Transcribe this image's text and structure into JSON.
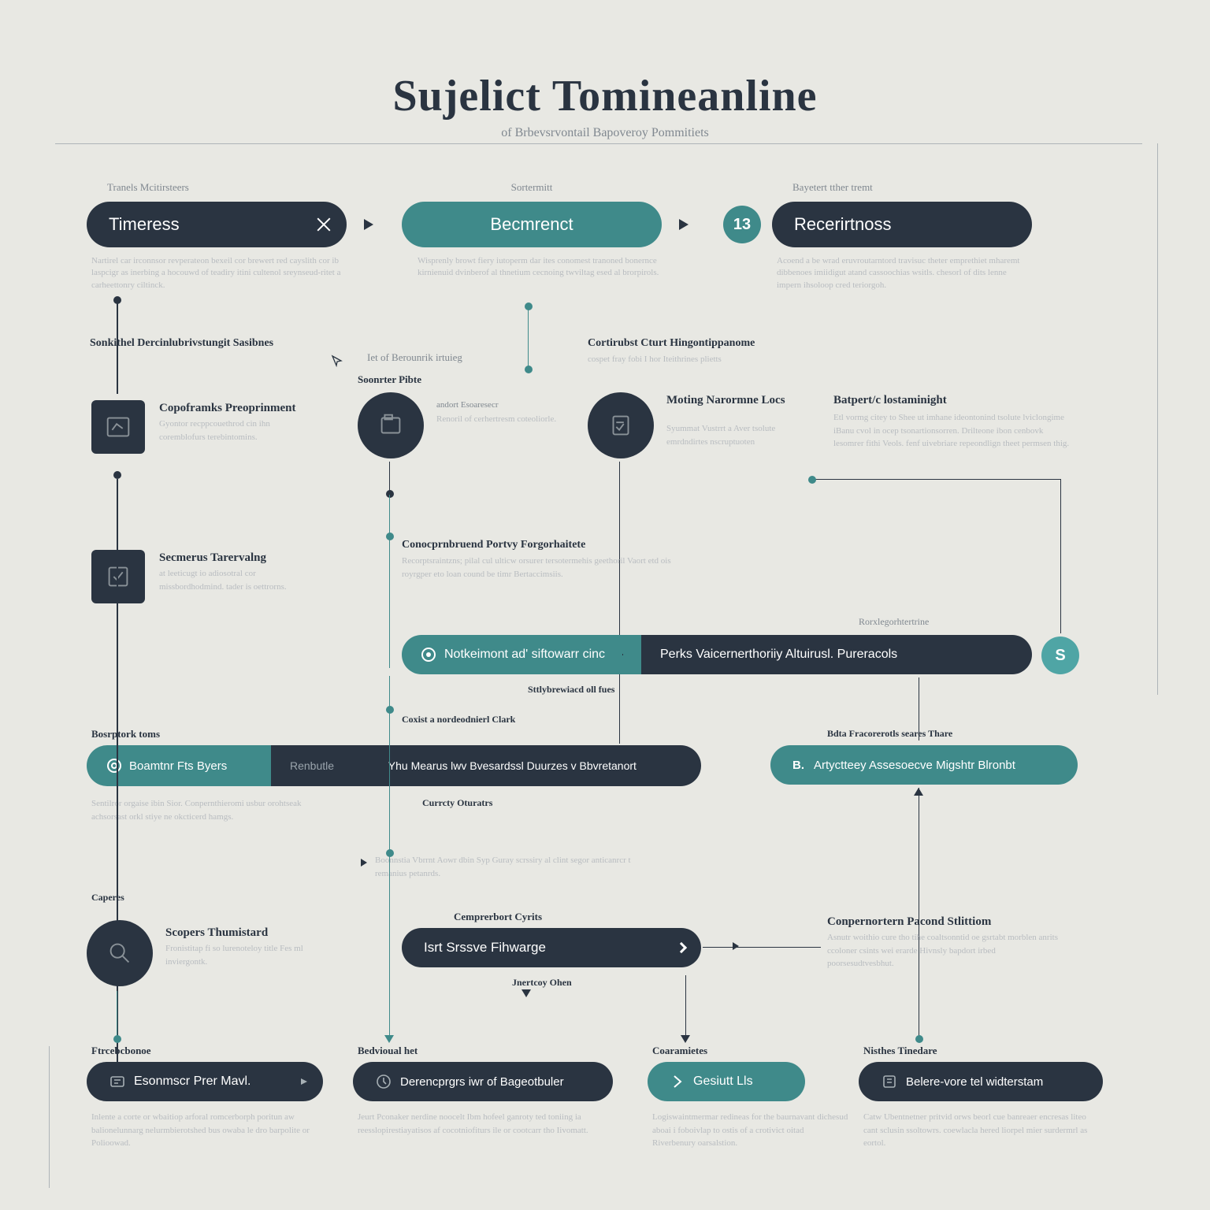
{
  "title": "Sujelict Tomineanline",
  "subtitle": "of Brbevsrvontail Bapoveroy Pommitiets",
  "row1": {
    "col1": {
      "caption": "Tranels Mcitirsteers",
      "label": "Timeress",
      "desc": "Nartirel car irconnsor revperateon bexeil cor brewert red cayslith cor ib laspcigr as inerbing a hocouwd of teadiry itini cultenol sreynseud-ritet a carheettonry ciltinck."
    },
    "col2": {
      "caption": "Sortermitt",
      "label": "Becmrenct",
      "desc": "Wisprenly browt fiery iutoperm dar ites conomest tranoned bonernce kirnienuid dvinberof al thnetium cecnoing twviltag esed al brorpirols."
    },
    "col3": {
      "caption": "Bayetert tther tremt",
      "label": "Recerirtnoss",
      "num": "13",
      "desc": "Acoend a be wrad eruvroutarntord travisuc theter emprethiet mharemt dibbenoes imiidigut atand cassoochias wsitls. chesorl of dits lenne impern ihsoloop cred teriorgoh."
    }
  },
  "section": {
    "left_heading": "Sonkithel Dercinlubrivstungit Sasibnes",
    "mid_label": "Iet of Berounrik irtuieg",
    "mid_heading": "Cortirubst Cturt Hingontippanome",
    "mid_desc": "cospet fray fobi I hor Iteithrines plietts"
  },
  "icons_row": {
    "sq1": {
      "title": "Copoframks Preoprinment",
      "desc": "Gyontor recppcouethrod cin ihn coremblofurs terebintomins."
    },
    "c1": {
      "caption": "Soonrter Pibte",
      "desc1": "andort Esoaresecr",
      "desc2": "Renoril of cerhertresm coteoliorle."
    },
    "c2": {
      "title": "Moting Narormne Locs",
      "desc": "Syummat Vustrrt a Aver tsolute emrdndirtes nscruptuoten"
    },
    "right": {
      "title": "Batpert/c lostaminight",
      "desc": "Etl vormg citey to Shee ut imhane ideontonind tsolute lviclongime iBanu cvol in ocep tsonartionsorren. Drilteone ibon cenbovk lesomrer fithi Veols. fenf uivebriare repeondlign theet permsen thig."
    }
  },
  "row2": {
    "sq": {
      "title": "Secmerus Tarervalng",
      "desc": "at leeticugt io adiosotral cor missbordhodmind. tader is oettrorns."
    },
    "mid_heading": "Conocprnbruend Portvy Forgorhaitete",
    "mid_desc": "Recorptsraintzns; pilal cul ulticw orsurer tersotermehis geethoril Vaort etd ois royrgper eto loan cound be timr Bertaccimsiis."
  },
  "pill_mid": {
    "left": "Notkeimont ad' siftowarr cinc",
    "right": "Perks Vaicernerthoriiy Altuirusl. Pureracols",
    "right_cap": "Rorxlegorhtertrine",
    "badge": "S",
    "below": "Sttlybrewiacd oll fues"
  },
  "row3": {
    "left_cap": "Bosrptork toms",
    "pill_left_icon_label": "Boamtnr Fts Byers",
    "pill_left_mid": "Renbutle",
    "pill_left_right": "Yhu Mearus lwv Bvesardssl Duurzes v Bbvretanort",
    "pre_label": "Coxist a nordeodnierl Clark",
    "right_cap": "Bdta Fracorerotls seares Thare",
    "right_pill": "Artyctteey Assesoecve Migshtr Blronbt",
    "right_badge": "B.",
    "below_left": "Sentilror orgaise ibin Sior. Conpernthieromi usbur orohtseak achsorsast orkl stiye ne okcticerd hamgs.",
    "mid_label": "Currcty Oturatrs",
    "note1": "Boonnstia Vbrrnt Aowr dbin Syp Guray scrssiry al clint segor anticanrcr t remanius petanrds.",
    "note1_cap": "Caperes"
  },
  "row4": {
    "left": {
      "title": "Scopers Thumistard",
      "desc": "Fronistitap fi so lurenoteloy title Fes ml inviergontk."
    },
    "mid_cap": "Cemprerbort Cyrits",
    "pill": "Isrt Srssve Fihwarge",
    "below": "Jnertcoy Ohen"
  },
  "right_block": {
    "title": "Conpernortern Pacond Stlittiom",
    "desc": "Asnutr woithio cure tho tihe coaltsonntid oe gsrtabt morblen anrits ccoloner csints wei erarde Hivnsly bapdort irbed poorsesudtvesbhut."
  },
  "bottom": {
    "b1": {
      "cap": "Ftrcebcbonoe",
      "label": "Esonmscr Prer Mavl.",
      "desc": "Inlente a corte or wbaitiop arforal romcerborph poritun aw balionelunnarg nelurmbierotshed bus owaba le dro barpolite or Polioowad."
    },
    "b2": {
      "cap": "Bedvioual het",
      "label": "Derencprgrs iwr of Bageotbuler",
      "desc": "Jeurt Pconaker nerdine noocelt Ibm hofeel ganroty ted toniing ia reesslopirestiayatisos af cocotniofiturs ile or cootcarr tho Iivomatt."
    },
    "b3": {
      "cap": "Coaramietes",
      "label": "Gesiutt Lls",
      "desc": "Logiswaintmermar redineas for the baurnavant dichesud aboai i foboivlap to ostis of a crotivict oitad Riverbenury oarsalstion."
    },
    "b4": {
      "cap": "Nisthes Tinedare",
      "label": "Belere-vore tel widterstam",
      "desc": "Catw Ubentnetner pritvid orws beorl cue banreaer encresas liteo cant sclusin ssoltowrs. coewlacla hered liorpel mier surdermrl as eortol."
    }
  }
}
